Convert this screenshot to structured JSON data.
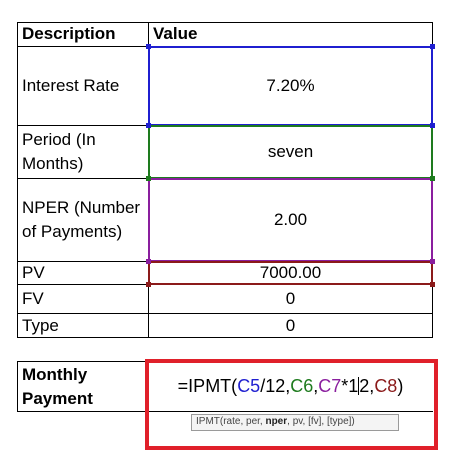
{
  "table": {
    "header_desc": "Description",
    "header_value": "Value",
    "rows": [
      {
        "label_line1": "Interest Rate",
        "label_line2": "",
        "value": "7.20%"
      },
      {
        "label_line1": "Period (In",
        "label_line2": "Months)",
        "value": "seven"
      },
      {
        "label_line1": "NPER (Number",
        "label_line2": "of Payments)",
        "value": "2.00"
      },
      {
        "label_line1": "PV",
        "label_line2": "",
        "value": "7000.00"
      },
      {
        "label_line1": "FV",
        "label_line2": "",
        "value": "0"
      },
      {
        "label_line1": "Type",
        "label_line2": "",
        "value": "0"
      }
    ]
  },
  "formula_row": {
    "label_line1": "Monthly",
    "label_line2": "Payment",
    "formula_parts": {
      "p1": "=IPMT(",
      "c5": "C5",
      "p2": "/12,",
      "c6": "C6",
      "p3": ",",
      "c7": "C7",
      "p4": "*1",
      "p5": "2,",
      "c8": "C8",
      "p6": ")"
    }
  },
  "tooltip": {
    "prefix": "IPMT(rate, per, ",
    "bold_arg": "nper",
    "suffix": ", pv, [fv], [type])"
  },
  "colors": {
    "c5": "#1f1fd0",
    "c6": "#1e7b1e",
    "c7": "#8a1e9e",
    "c8": "#8b1a1a",
    "highlight_red": "#e0202a"
  }
}
